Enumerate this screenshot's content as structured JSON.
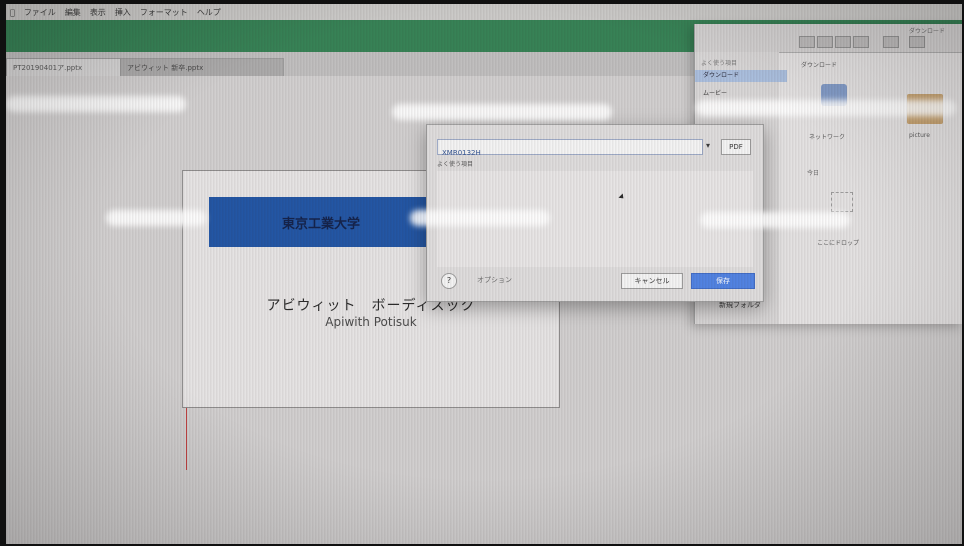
{
  "menubar": {
    "items": [
      "ファイル",
      "編集",
      "表示",
      "挿入",
      "フォーマット",
      "ヘルプ"
    ]
  },
  "tabs": [
    "PT20190401ア.pptx",
    "アビウィット 新卒.pptx"
  ],
  "slide": {
    "banner": "東京工業大学",
    "name_jp": "アビウィット　ボーディスック",
    "name_en": "Apiwith Potisuk"
  },
  "dialog": {
    "save_as_value": "XMR0132H",
    "format_button": "PDF",
    "location_label": "よく使う項目",
    "help_label": "?",
    "options_label": "オプション",
    "cancel_label": "キャンセル",
    "save_label": "保存"
  },
  "finder": {
    "title": "ダウンロード",
    "sidebar_header": "よく使う項目",
    "sidebar_selected": "ダウンロード",
    "sidebar_item": "ムービー",
    "path": "ダウンロード",
    "item1_caption": "ネットワーク",
    "item2_caption": "picture",
    "date_label": "今日",
    "drop_caption": "ここにドロップ",
    "bottom_label": "新規フォルダ"
  },
  "colors": {
    "brand_blue": "#1a4fa0",
    "toolbar_green": "#2f7d4f",
    "primary_button": "#4a7de0"
  }
}
